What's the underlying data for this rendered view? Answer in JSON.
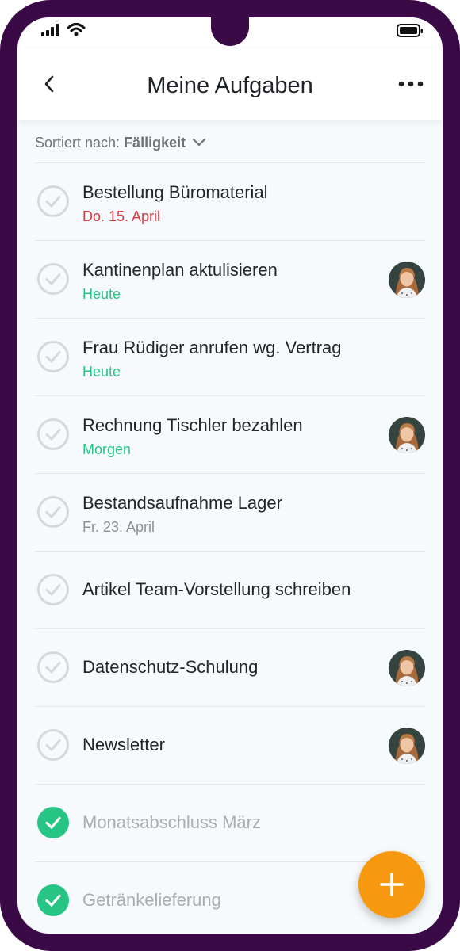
{
  "header": {
    "title": "Meine Aufgaben",
    "back_icon": "chevron-left-icon",
    "more_icon": "more-horizontal-icon"
  },
  "sort": {
    "label": "Sortiert nach:",
    "value": "Fälligkeit"
  },
  "colors": {
    "frame": "#3a0a46",
    "overdue": "#d9383f",
    "soon": "#26c485",
    "future": "#8b8f94",
    "done_check": "#26c485",
    "fab": "#f7990e"
  },
  "tasks": [
    {
      "title": "Bestellung Büromaterial",
      "date": "Do. 15. April",
      "date_color": "#d9383f",
      "done": false,
      "avatar": false
    },
    {
      "title": "Kantinenplan aktulisieren",
      "date": "Heute",
      "date_color": "#26c485",
      "done": false,
      "avatar": true
    },
    {
      "title": "Frau Rüdiger anrufen wg. Vertrag",
      "date": "Heute",
      "date_color": "#26c485",
      "done": false,
      "avatar": false
    },
    {
      "title": "Rechnung Tischler bezahlen",
      "date": "Morgen",
      "date_color": "#26c485",
      "done": false,
      "avatar": true
    },
    {
      "title": "Bestandsaufnahme Lager",
      "date": "Fr. 23. April",
      "date_color": "#8b8f94",
      "done": false,
      "avatar": false
    },
    {
      "title": "Artikel Team-Vorstellung schreiben",
      "date": "",
      "date_color": "",
      "done": false,
      "avatar": false
    },
    {
      "title": "Datenschutz-Schulung",
      "date": "",
      "date_color": "",
      "done": false,
      "avatar": true
    },
    {
      "title": "Newsletter",
      "date": "",
      "date_color": "",
      "done": false,
      "avatar": true
    },
    {
      "title": "Monatsabschluss März",
      "date": "",
      "date_color": "",
      "done": true,
      "avatar": false
    },
    {
      "title": "Getränkelieferung",
      "date": "",
      "date_color": "",
      "done": true,
      "avatar": false
    }
  ],
  "fab": {
    "icon": "plus-icon"
  }
}
